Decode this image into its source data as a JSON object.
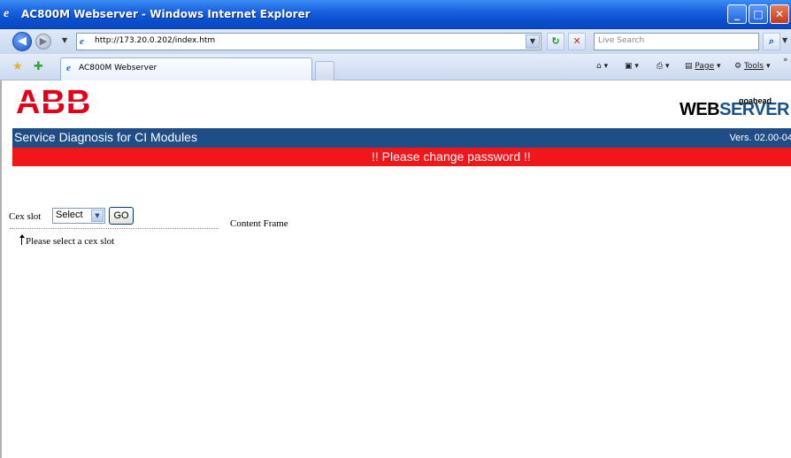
{
  "window": {
    "title": "AC800M Webserver - Windows Internet Explorer",
    "controls": {
      "minimize": "_",
      "maximize": "□",
      "close": "✕"
    }
  },
  "address_bar": {
    "url": "http://173.20.0.202/index.htm",
    "search_placeholder": "Live Search"
  },
  "tabs": [
    {
      "label": "AC800M Webserver"
    }
  ],
  "command_bar": {
    "page_label": "Page",
    "tools_label": "Tools"
  },
  "header": {
    "logo_letters": [
      "A",
      "B",
      "B"
    ],
    "webserver_brand": {
      "prefix": "goahead",
      "web": "WEB",
      "server": "SERVER"
    },
    "app_title": "Service Diagnosis for CI Modules",
    "version": "Vers. 02.00-04"
  },
  "warning": "!! Please change password !!",
  "nav": {
    "cex_label": "Cex slot",
    "select_value": "Select",
    "go_label": "GO",
    "hint": "Please select a cex slot"
  },
  "content_frame_label": "Content Frame",
  "colors": {
    "abb_red": "#e2001a",
    "header_blue": "#1f4e86",
    "warning_red": "#f1161a",
    "titlebar_blue": "#0a4fd0"
  }
}
